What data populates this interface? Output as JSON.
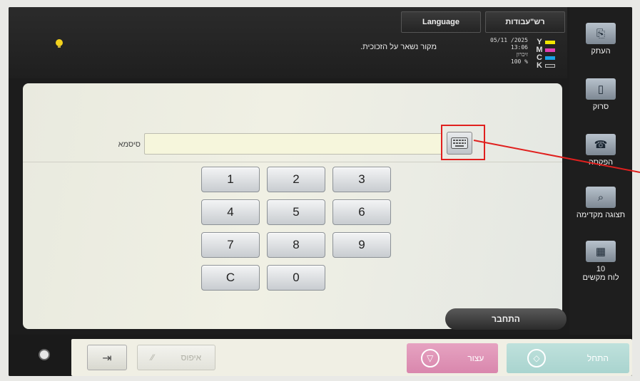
{
  "header": {
    "language_label": "Language",
    "jobs_label": "רש\"עבודות",
    "message": "מקור נשאר על הזכוכית.",
    "date": "05/11 /2025",
    "time": "13:06",
    "memory_label": "זיכרון",
    "memory_value": "100 %",
    "toner": [
      {
        "letter": "Y",
        "color": "#f2e600"
      },
      {
        "letter": "M",
        "color": "#e23fb3"
      },
      {
        "letter": "C",
        "color": "#1aa3e8"
      },
      {
        "letter": "K",
        "color": "#2a2a2a"
      }
    ]
  },
  "sidebar": {
    "items": [
      {
        "label": "העתק",
        "icon": "copy-icon"
      },
      {
        "label": "סרוק",
        "icon": "scan-icon"
      },
      {
        "label": "הפקסה",
        "icon": "fax-icon"
      },
      {
        "label": "תצוגה מקדימה",
        "icon": "preview-icon"
      },
      {
        "label": "לוח מקשים",
        "icon": "keypad-icon",
        "count": "10"
      }
    ]
  },
  "login": {
    "password_label": "סיסמא",
    "password_value": "",
    "keypad": [
      "1",
      "2",
      "3",
      "4",
      "5",
      "6",
      "7",
      "8",
      "9",
      "C",
      "0"
    ],
    "connect_label": "התחבר"
  },
  "footer": {
    "reset_label": "איפוס",
    "stop_label": "עצור",
    "start_label": "התחל"
  },
  "colors": {
    "annotation": "#e0201e",
    "stop": "#d987ad",
    "start": "#a9d4cf"
  }
}
